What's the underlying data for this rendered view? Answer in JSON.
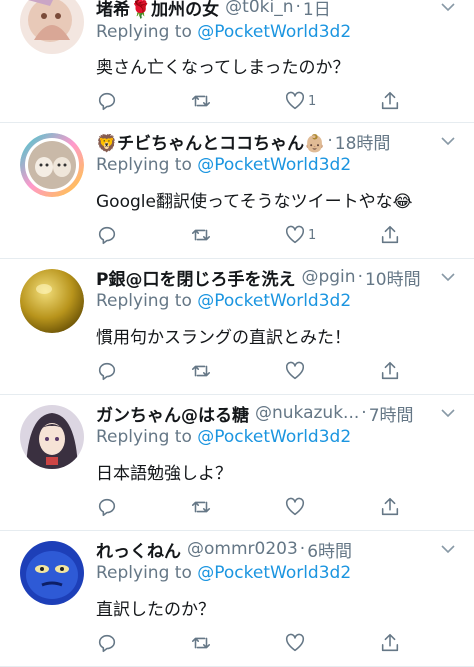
{
  "tweets": [
    {
      "name": "堵希🌹加州の女",
      "handle": "@t0ki_n",
      "time": "1日",
      "reply_prefix": "Replying to",
      "mention": "@PocketWorld3d2",
      "text": "奥さん亡くなってしまったのか？",
      "likes": "1"
    },
    {
      "name": "🦁チビちゃんとココちゃん👶🏼",
      "handle": "",
      "time": "18時間",
      "reply_prefix": "Replying to",
      "mention": "@PocketWorld3d2",
      "text": "Google翻訳使ってそうなツイートやな😂",
      "likes": "1"
    },
    {
      "name": "P銀@口を閉じろ手を洗え",
      "handle": "@pgin",
      "time": "10時間",
      "reply_prefix": "Replying to",
      "mention": "@PocketWorld3d2",
      "text": "慣用句かスラングの直訳とみた！",
      "likes": ""
    },
    {
      "name": "ガンちゃん@はる糖",
      "handle": "@nukazuk...",
      "time": "7時間",
      "reply_prefix": "Replying to",
      "mention": "@PocketWorld3d2",
      "text": "日本語勉強しよ？",
      "likes": ""
    },
    {
      "name": "れっくねん",
      "handle": "@ommr0203",
      "time": "6時間",
      "reply_prefix": "Replying to",
      "mention": "@PocketWorld3d2",
      "text": "直訳したのか？",
      "likes": ""
    }
  ],
  "icons": {
    "reply": "reply-icon",
    "retweet": "retweet-icon",
    "like": "heart-icon",
    "share": "share-icon",
    "caret": "chevron-down-icon"
  },
  "colors": {
    "accent": "#1b95e0",
    "secondary_text": "#657786",
    "divider": "#e6ecf0"
  }
}
